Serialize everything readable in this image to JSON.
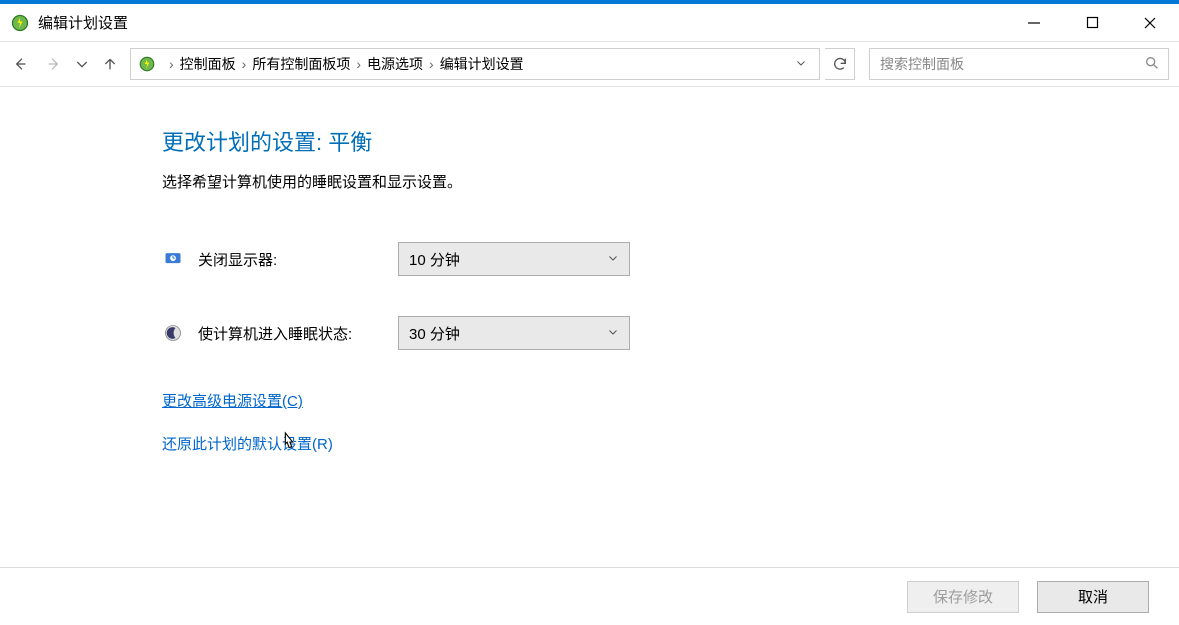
{
  "window": {
    "title": "编辑计划设置"
  },
  "breadcrumb": {
    "items": [
      "控制面板",
      "所有控制面板项",
      "电源选项",
      "编辑计划设置"
    ]
  },
  "search": {
    "placeholder": "搜索控制面板"
  },
  "heading": "更改计划的设置: 平衡",
  "subtext": "选择希望计算机使用的睡眠设置和显示设置。",
  "settings": {
    "display_off": {
      "label": "关闭显示器:",
      "value": "10 分钟"
    },
    "sleep": {
      "label": "使计算机进入睡眠状态:",
      "value": "30 分钟"
    }
  },
  "links": {
    "advanced": "更改高级电源设置(C)",
    "restore": "还原此计划的默认设置(R)"
  },
  "buttons": {
    "save": "保存修改",
    "cancel": "取消"
  }
}
